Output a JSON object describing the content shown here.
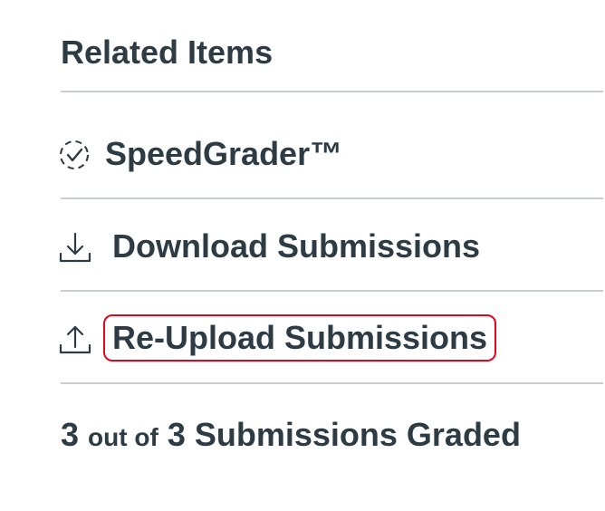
{
  "related": {
    "heading": "Related Items",
    "items": [
      {
        "label": "SpeedGrader™",
        "icon": "speedgrader-icon"
      },
      {
        "label": "Download Submissions",
        "icon": "download-icon"
      },
      {
        "label": "Re-Upload Submissions",
        "icon": "upload-icon",
        "highlighted": true
      }
    ],
    "graded": {
      "count": "3",
      "out_of": "out of",
      "total": "3",
      "suffix": "Submissions Graded"
    }
  },
  "colors": {
    "text": "#2d3b45",
    "divider": "#c7cdd1",
    "highlight_border": "#e0061f"
  }
}
